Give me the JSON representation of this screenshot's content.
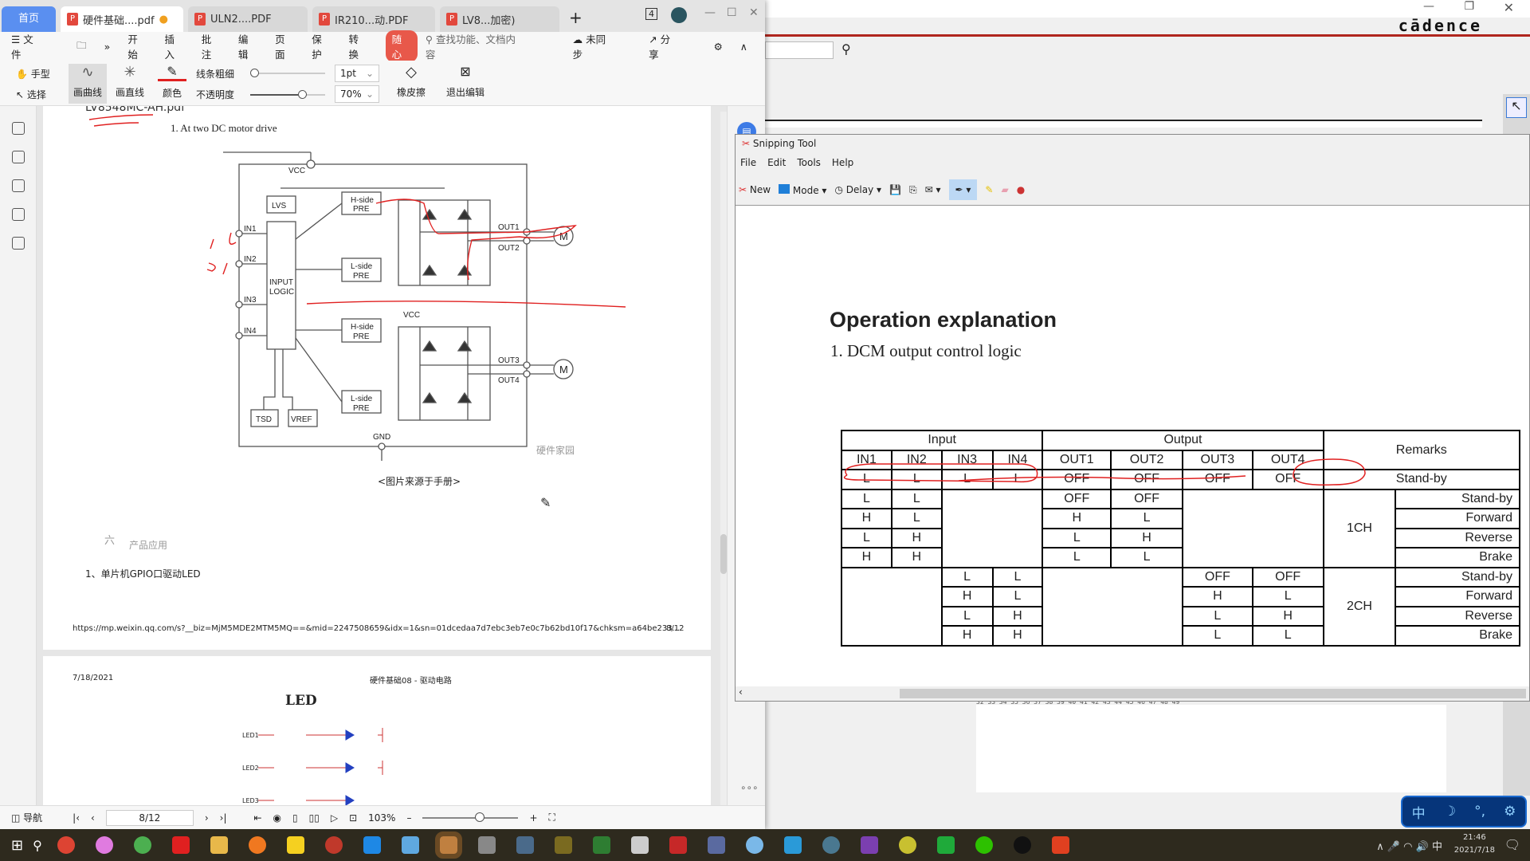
{
  "wps": {
    "home_tab": "首页",
    "tabs": [
      {
        "label": "硬件基础....pdf",
        "active": true
      },
      {
        "label": "ULN2....PDF"
      },
      {
        "label": "IR210...动.PDF"
      },
      {
        "label": "LV8...加密)"
      }
    ],
    "tab_count_badge": "4",
    "menu": {
      "file": "文件",
      "items": [
        "开始",
        "插入",
        "批注",
        "编辑",
        "页面",
        "保护",
        "转换"
      ],
      "highlight": "随心",
      "search_placeholder": "查找功能、文档内容",
      "sync": "未同步",
      "share": "分享"
    },
    "toolbar": {
      "hand": "手型",
      "select": "选择",
      "curve": "画曲线",
      "line": "画直线",
      "color": "颜色",
      "thickness_label": "线条粗细",
      "thickness_value": "1pt",
      "opacity_label": "不透明度",
      "opacity_value": "70%",
      "eraser": "橡皮擦",
      "exit": "退出编辑",
      "opacity_level": 0.7
    },
    "page1": {
      "filename": "LV8548MC-AH.pdf",
      "heading": "1. At two DC motor drive",
      "schematic": {
        "vcc": "VCC",
        "lvs": "LVS",
        "input_logic": [
          "INPUT",
          "LOGIC"
        ],
        "inputs": [
          "IN1",
          "IN2",
          "IN3",
          "IN4"
        ],
        "hside": [
          "H-side",
          "PRE"
        ],
        "lside": [
          "L-side",
          "PRE"
        ],
        "outputs": [
          "OUT1",
          "OUT2",
          "OUT3",
          "OUT4"
        ],
        "motor": "M",
        "tsd": "TSD",
        "vref": "VREF",
        "gnd": "GND",
        "watermark": "硬件家园"
      },
      "caption": "<图片来源于手册>",
      "section_num": "六",
      "section_title": "产品应用",
      "item": "1、单片机GPIO口驱动LED",
      "url": "https://mp.weixin.qq.com/s?__biz=MjM5MDE2MTM5MQ==&mid=2247508659&idx=1&sn=01dcedaa7d7ebc3eb7e0c7b62bd10f17&chksm=a64be233...",
      "page_of": "8/12"
    },
    "page2": {
      "date": "7/18/2021",
      "title": "硬件基础08 - 驱动电路",
      "heading": "LED",
      "leds": [
        "LED1",
        "LED2",
        "LED3"
      ]
    },
    "status": {
      "nav": "导航",
      "page": "8/12",
      "zoom": "103%"
    }
  },
  "cadence": {
    "logo": "cādence",
    "ruler_marks": "32  33  34  35  36  37  38  39  40  41  42  43  44  45  46  47  48  49"
  },
  "ime": [
    "中",
    "☽",
    "°,",
    "⚙"
  ],
  "snipping": {
    "title": "Snipping Tool",
    "menu": [
      "File",
      "Edit",
      "Tools",
      "Help"
    ],
    "tools": {
      "new": "New",
      "mode": "Mode",
      "delay": "Delay"
    },
    "content": {
      "title": "Operation explanation",
      "subtitle": "1. DCM output control logic",
      "table": {
        "group_headers": [
          "Input",
          "Output",
          "Remarks"
        ],
        "columns": [
          "IN1",
          "IN2",
          "IN3",
          "IN4",
          "OUT1",
          "OUT2",
          "OUT3",
          "OUT4"
        ],
        "standby_row": {
          "cells": [
            "L",
            "L",
            "L",
            "L",
            "OFF",
            "OFF",
            "OFF",
            "OFF"
          ],
          "remark": "Stand-by"
        },
        "ch1": {
          "label": "1CH",
          "rows": [
            {
              "in": [
                "L",
                "L"
              ],
              "out": [
                "OFF",
                "OFF"
              ],
              "remark": "Stand-by"
            },
            {
              "in": [
                "H",
                "L"
              ],
              "out": [
                "H",
                "L"
              ],
              "remark": "Forward"
            },
            {
              "in": [
                "L",
                "H"
              ],
              "out": [
                "L",
                "H"
              ],
              "remark": "Reverse"
            },
            {
              "in": [
                "H",
                "H"
              ],
              "out": [
                "L",
                "L"
              ],
              "remark": "Brake"
            }
          ]
        },
        "ch2": {
          "label": "2CH",
          "rows": [
            {
              "in": [
                "L",
                "L"
              ],
              "out": [
                "OFF",
                "OFF"
              ],
              "remark": "Stand-by"
            },
            {
              "in": [
                "H",
                "L"
              ],
              "out": [
                "H",
                "L"
              ],
              "remark": "Forward"
            },
            {
              "in": [
                "L",
                "H"
              ],
              "out": [
                "L",
                "H"
              ],
              "remark": "Reverse"
            },
            {
              "in": [
                "H",
                "H"
              ],
              "out": [
                "L",
                "L"
              ],
              "remark": "Brake"
            }
          ]
        }
      }
    }
  },
  "taskbar": {
    "time": "21:46",
    "date": "2021/7/18",
    "tray_ime": "中"
  },
  "colors": {
    "annotation_red": "#e02020",
    "wps_home": "#5a8ff0",
    "cadence_red": "#b0261e"
  }
}
